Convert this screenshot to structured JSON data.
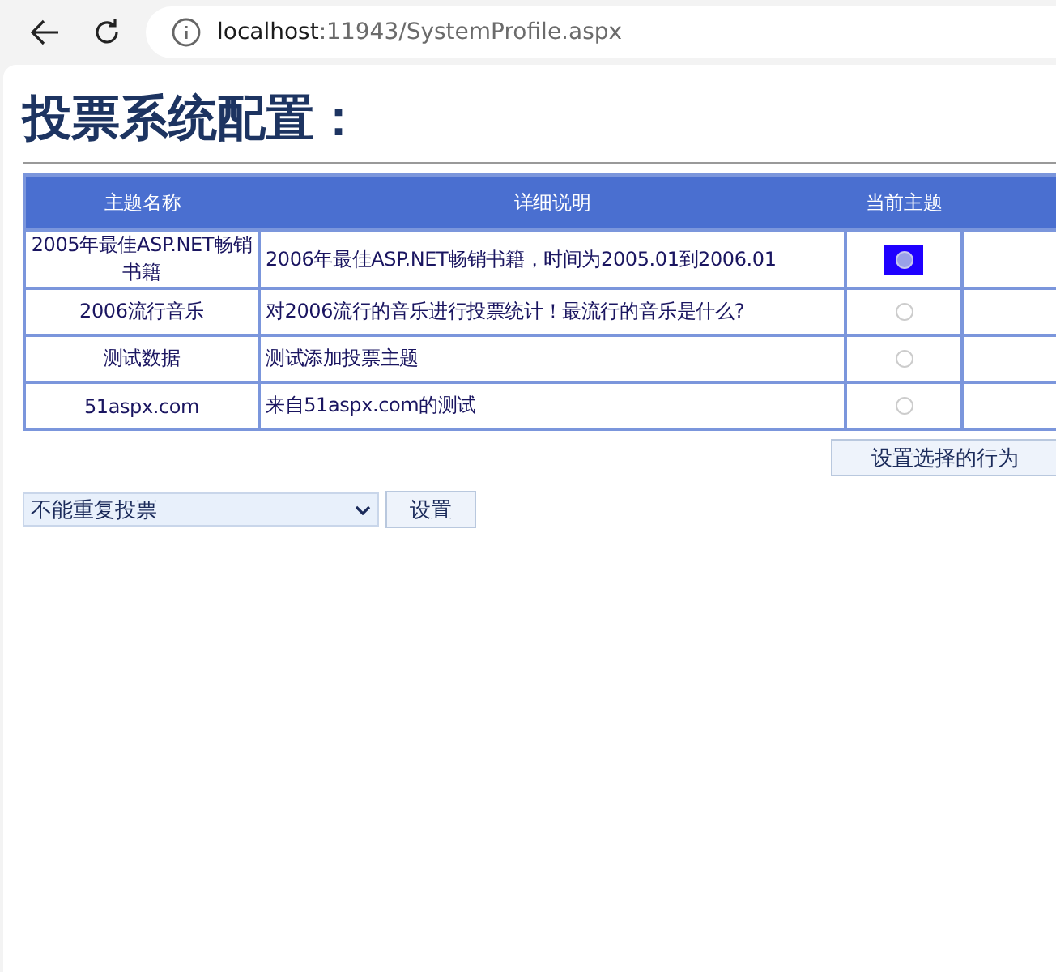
{
  "browser": {
    "url_host": "localhost",
    "url_rest": ":11943/SystemProfile.aspx"
  },
  "title": "投票系统配置：",
  "table": {
    "columns": [
      "主题名称",
      "详细说明",
      "当前主题"
    ],
    "rows": [
      {
        "name": "2005年最佳ASP.NET畅销书籍",
        "description": "2006年最佳ASP.NET畅销书籍，时间为2005.01到2006.01",
        "selected": true
      },
      {
        "name": "2006流行音乐",
        "description": "对2006流行的音乐进行投票统计！最流行的音乐是什么?",
        "selected": false
      },
      {
        "name": "测试数据",
        "description": "测试添加投票主题",
        "selected": false
      },
      {
        "name": "51aspx.com",
        "description": "来自51aspx.com的测试",
        "selected": false
      }
    ]
  },
  "set_selected_button": "设置选择的行为",
  "vote_mode": {
    "value": "不能重复投票"
  },
  "set_button": "设置"
}
